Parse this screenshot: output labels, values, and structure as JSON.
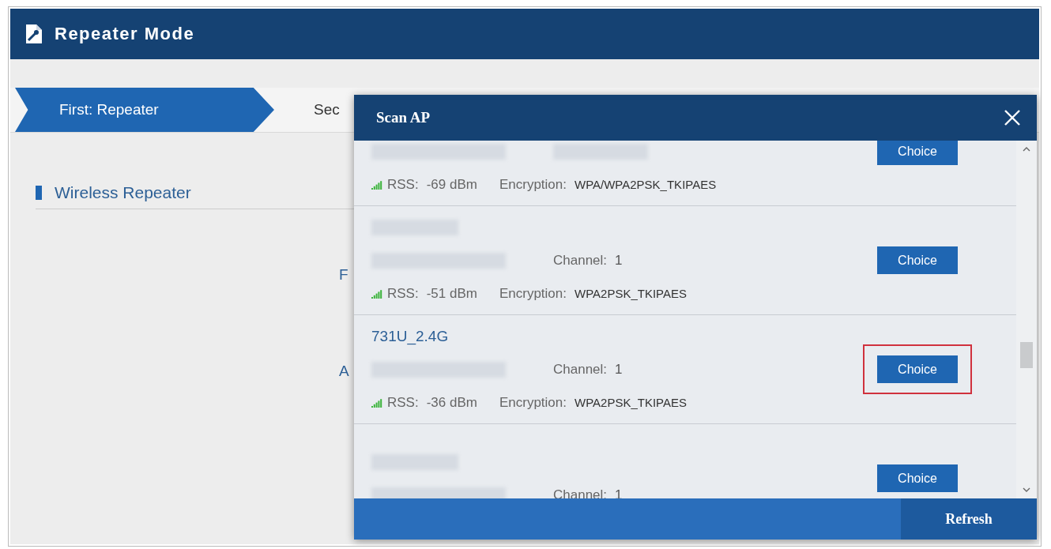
{
  "header": {
    "title": "Repeater Mode"
  },
  "steps": [
    {
      "label": "First: Repeater",
      "selected": true
    },
    {
      "label": "Sec",
      "selected": false
    }
  ],
  "section": {
    "title": "Wireless Repeater"
  },
  "hidden_labels": [
    "F",
    "A"
  ],
  "dialog": {
    "title": "Scan AP",
    "refresh": "Refresh",
    "networks": [
      {
        "rss_label": "RSS:",
        "rss": "-69 dBm",
        "encryption_label": "Encryption:",
        "encryption": "WPA/WPA2PSK_TKIPAES",
        "button": "Choice",
        "highlighted": false
      },
      {
        "channel_label": "Channel:",
        "channel": "1",
        "rss_label": "RSS:",
        "rss": "-51 dBm",
        "encryption_label": "Encryption:",
        "encryption": "WPA2PSK_TKIPAES",
        "button": "Choice",
        "highlighted": false
      },
      {
        "name": "731U_2.4G",
        "channel_label": "Channel:",
        "channel": "1",
        "rss_label": "RSS:",
        "rss": "-36 dBm",
        "encryption_label": "Encryption:",
        "encryption": "WPA2PSK_TKIPAES",
        "button": "Choice",
        "highlighted": true
      },
      {
        "channel_label": "Channel:",
        "channel": "1",
        "button": "Choice",
        "highlighted": false
      }
    ]
  }
}
